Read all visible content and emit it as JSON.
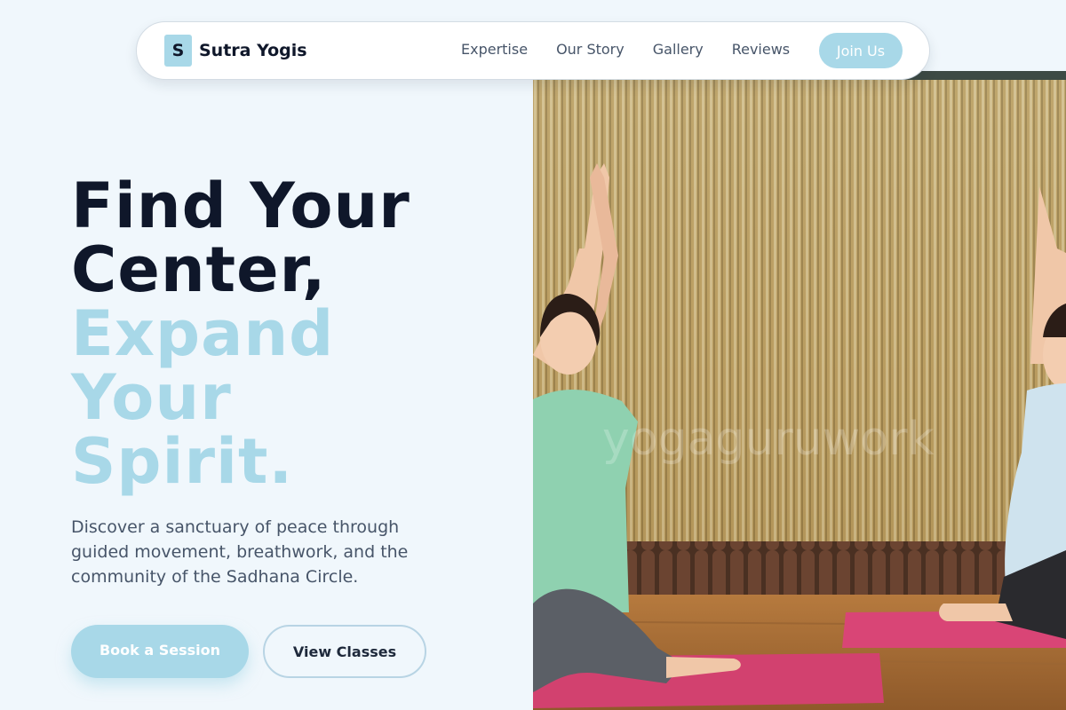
{
  "nav": {
    "brand_mark": "S",
    "brand_name": "Sutra Yogis",
    "links": [
      "Expertise",
      "Our Story",
      "Gallery",
      "Reviews"
    ],
    "cta": "Join Us"
  },
  "hero": {
    "title_dark": [
      "Find Your",
      "Center,"
    ],
    "title_light": [
      "Expand",
      "Your",
      "Spirit."
    ],
    "subtitle": "Discover a sanctuary of peace through guided movement, breathwork, and the community of the Sadhana Circle.",
    "primary_button": "Book a Session",
    "secondary_button": "View Classes"
  },
  "image": {
    "watermark": "yogaguruwork"
  },
  "colors": {
    "accent": "#a8d8e8",
    "heading": "#0f172a",
    "body_text": "#475569",
    "background": "#f0f7fc"
  }
}
